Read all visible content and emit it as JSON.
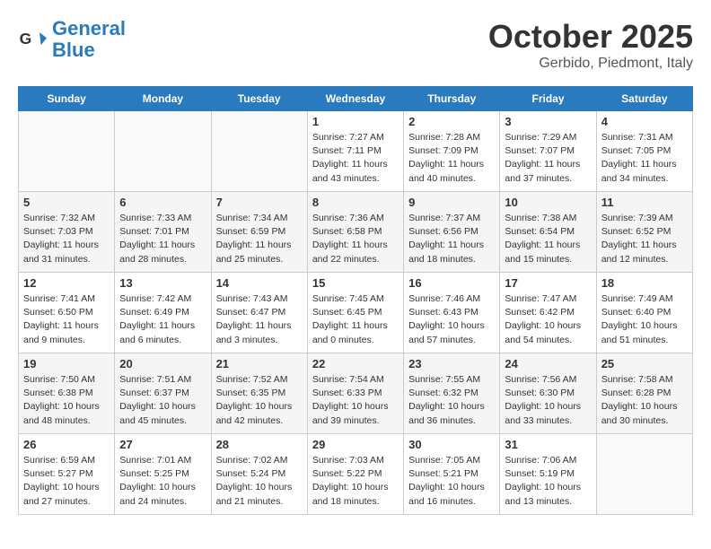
{
  "header": {
    "logo_line1": "General",
    "logo_line2": "Blue",
    "month": "October 2025",
    "location": "Gerbido, Piedmont, Italy"
  },
  "days_of_week": [
    "Sunday",
    "Monday",
    "Tuesday",
    "Wednesday",
    "Thursday",
    "Friday",
    "Saturday"
  ],
  "weeks": [
    [
      {
        "day": "",
        "info": ""
      },
      {
        "day": "",
        "info": ""
      },
      {
        "day": "",
        "info": ""
      },
      {
        "day": "1",
        "info": "Sunrise: 7:27 AM\nSunset: 7:11 PM\nDaylight: 11 hours\nand 43 minutes."
      },
      {
        "day": "2",
        "info": "Sunrise: 7:28 AM\nSunset: 7:09 PM\nDaylight: 11 hours\nand 40 minutes."
      },
      {
        "day": "3",
        "info": "Sunrise: 7:29 AM\nSunset: 7:07 PM\nDaylight: 11 hours\nand 37 minutes."
      },
      {
        "day": "4",
        "info": "Sunrise: 7:31 AM\nSunset: 7:05 PM\nDaylight: 11 hours\nand 34 minutes."
      }
    ],
    [
      {
        "day": "5",
        "info": "Sunrise: 7:32 AM\nSunset: 7:03 PM\nDaylight: 11 hours\nand 31 minutes."
      },
      {
        "day": "6",
        "info": "Sunrise: 7:33 AM\nSunset: 7:01 PM\nDaylight: 11 hours\nand 28 minutes."
      },
      {
        "day": "7",
        "info": "Sunrise: 7:34 AM\nSunset: 6:59 PM\nDaylight: 11 hours\nand 25 minutes."
      },
      {
        "day": "8",
        "info": "Sunrise: 7:36 AM\nSunset: 6:58 PM\nDaylight: 11 hours\nand 22 minutes."
      },
      {
        "day": "9",
        "info": "Sunrise: 7:37 AM\nSunset: 6:56 PM\nDaylight: 11 hours\nand 18 minutes."
      },
      {
        "day": "10",
        "info": "Sunrise: 7:38 AM\nSunset: 6:54 PM\nDaylight: 11 hours\nand 15 minutes."
      },
      {
        "day": "11",
        "info": "Sunrise: 7:39 AM\nSunset: 6:52 PM\nDaylight: 11 hours\nand 12 minutes."
      }
    ],
    [
      {
        "day": "12",
        "info": "Sunrise: 7:41 AM\nSunset: 6:50 PM\nDaylight: 11 hours\nand 9 minutes."
      },
      {
        "day": "13",
        "info": "Sunrise: 7:42 AM\nSunset: 6:49 PM\nDaylight: 11 hours\nand 6 minutes."
      },
      {
        "day": "14",
        "info": "Sunrise: 7:43 AM\nSunset: 6:47 PM\nDaylight: 11 hours\nand 3 minutes."
      },
      {
        "day": "15",
        "info": "Sunrise: 7:45 AM\nSunset: 6:45 PM\nDaylight: 11 hours\nand 0 minutes."
      },
      {
        "day": "16",
        "info": "Sunrise: 7:46 AM\nSunset: 6:43 PM\nDaylight: 10 hours\nand 57 minutes."
      },
      {
        "day": "17",
        "info": "Sunrise: 7:47 AM\nSunset: 6:42 PM\nDaylight: 10 hours\nand 54 minutes."
      },
      {
        "day": "18",
        "info": "Sunrise: 7:49 AM\nSunset: 6:40 PM\nDaylight: 10 hours\nand 51 minutes."
      }
    ],
    [
      {
        "day": "19",
        "info": "Sunrise: 7:50 AM\nSunset: 6:38 PM\nDaylight: 10 hours\nand 48 minutes."
      },
      {
        "day": "20",
        "info": "Sunrise: 7:51 AM\nSunset: 6:37 PM\nDaylight: 10 hours\nand 45 minutes."
      },
      {
        "day": "21",
        "info": "Sunrise: 7:52 AM\nSunset: 6:35 PM\nDaylight: 10 hours\nand 42 minutes."
      },
      {
        "day": "22",
        "info": "Sunrise: 7:54 AM\nSunset: 6:33 PM\nDaylight: 10 hours\nand 39 minutes."
      },
      {
        "day": "23",
        "info": "Sunrise: 7:55 AM\nSunset: 6:32 PM\nDaylight: 10 hours\nand 36 minutes."
      },
      {
        "day": "24",
        "info": "Sunrise: 7:56 AM\nSunset: 6:30 PM\nDaylight: 10 hours\nand 33 minutes."
      },
      {
        "day": "25",
        "info": "Sunrise: 7:58 AM\nSunset: 6:28 PM\nDaylight: 10 hours\nand 30 minutes."
      }
    ],
    [
      {
        "day": "26",
        "info": "Sunrise: 6:59 AM\nSunset: 5:27 PM\nDaylight: 10 hours\nand 27 minutes."
      },
      {
        "day": "27",
        "info": "Sunrise: 7:01 AM\nSunset: 5:25 PM\nDaylight: 10 hours\nand 24 minutes."
      },
      {
        "day": "28",
        "info": "Sunrise: 7:02 AM\nSunset: 5:24 PM\nDaylight: 10 hours\nand 21 minutes."
      },
      {
        "day": "29",
        "info": "Sunrise: 7:03 AM\nSunset: 5:22 PM\nDaylight: 10 hours\nand 18 minutes."
      },
      {
        "day": "30",
        "info": "Sunrise: 7:05 AM\nSunset: 5:21 PM\nDaylight: 10 hours\nand 16 minutes."
      },
      {
        "day": "31",
        "info": "Sunrise: 7:06 AM\nSunset: 5:19 PM\nDaylight: 10 hours\nand 13 minutes."
      },
      {
        "day": "",
        "info": ""
      }
    ]
  ]
}
